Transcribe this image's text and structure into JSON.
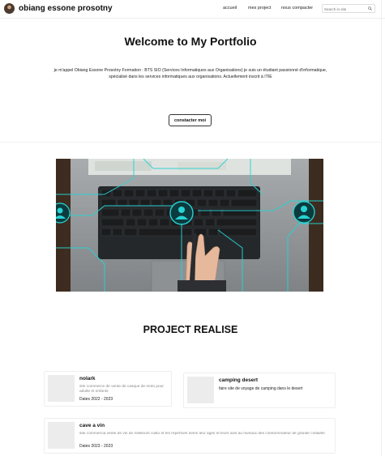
{
  "header": {
    "brand": "obiang essone prosotny",
    "nav": [
      "accueil",
      "mes project",
      "nous compacter"
    ],
    "search_placeholder": "Search in site"
  },
  "hero": {
    "title": "Welcome to My Portfolio",
    "intro": "je m'appel Obiang Essone Prosotny Formation : BTS SIO (Services Informatiques aux Organisations) je suis un étudiant passionné d'informatique, spécialisé dans les services informatiques aux organisations. Actuellement inscrit à ITIE",
    "cta_label": "constacter moi"
  },
  "projects": {
    "title": "PROJECT REALISE",
    "items": [
      {
        "title": "nolark",
        "description": "site commerce de vente de casque de moto pour adulte et enfants",
        "dates": "Dates 2022 - 2023"
      },
      {
        "title": "camping desert",
        "description": "faire site de voyage de camping dans le desert",
        "dates": ""
      },
      {
        "title": "cave a vin",
        "description": "site commercia vente de vin de meilleurs cuiltu et les repertoirs selon leur ages et leurs avis au niveaux des consommateur de grande cofiaelle",
        "dates": "Dates 2023 - 2023"
      }
    ]
  },
  "colors": {
    "accent": "#27d3d3",
    "text": "#111111"
  },
  "icons": [
    "avatar",
    "search-icon",
    "user-node-icon"
  ]
}
